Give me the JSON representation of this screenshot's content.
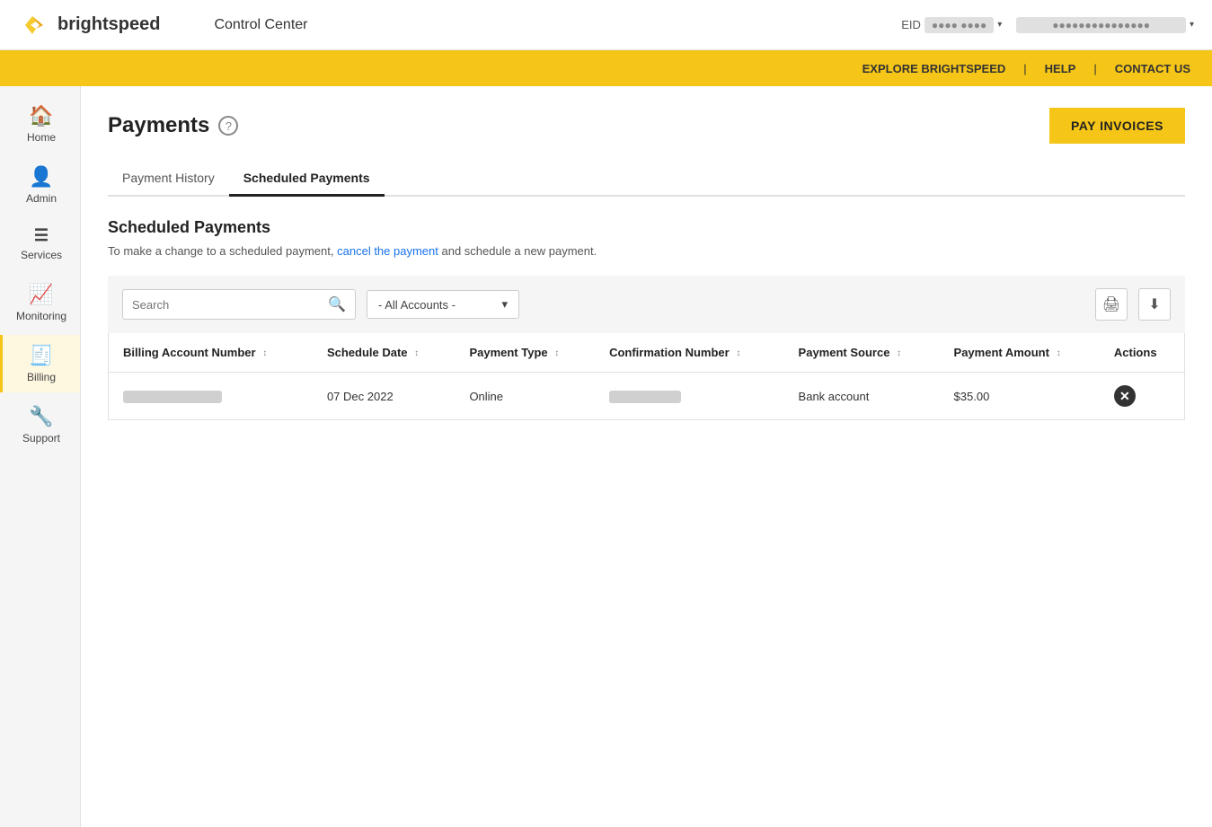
{
  "topnav": {
    "logo_text": "brightspeed",
    "app_title": "Control Center",
    "eid_label": "EID",
    "eid_value": "●●●● ●●●●",
    "user_value": "●●●●●●●●●●●●●●●",
    "chevron": "▾"
  },
  "yellowbar": {
    "links": [
      "EXPLORE BRIGHTSPEED",
      "HELP",
      "CONTACT US"
    ]
  },
  "sidebar": {
    "items": [
      {
        "id": "home",
        "icon": "🏠",
        "label": "Home"
      },
      {
        "id": "admin",
        "icon": "👤",
        "label": "Admin"
      },
      {
        "id": "services",
        "icon": "≡",
        "label": "Services"
      },
      {
        "id": "monitoring",
        "icon": "📊",
        "label": "Monitoring"
      },
      {
        "id": "billing",
        "icon": "🧾",
        "label": "Billing",
        "active": true
      },
      {
        "id": "support",
        "icon": "🔧",
        "label": "Support"
      }
    ]
  },
  "page": {
    "title": "Payments",
    "help_icon": "?",
    "pay_invoices_btn": "PAY INVOICES"
  },
  "tabs": [
    {
      "id": "payment-history",
      "label": "Payment History",
      "active": false
    },
    {
      "id": "scheduled-payments",
      "label": "Scheduled Payments",
      "active": true
    }
  ],
  "section": {
    "title": "Scheduled Payments",
    "description_prefix": "To make a change to a scheduled payment,",
    "description_link": "cancel the payment",
    "description_suffix": "and schedule a new payment."
  },
  "filter": {
    "search_placeholder": "Search",
    "accounts_label": "- All Accounts -",
    "print_icon": "🖨",
    "download_icon": "⬇"
  },
  "table": {
    "columns": [
      {
        "id": "billing-account",
        "label": "Billing Account Number"
      },
      {
        "id": "schedule-date",
        "label": "Schedule Date"
      },
      {
        "id": "payment-type",
        "label": "Payment Type"
      },
      {
        "id": "confirmation-number",
        "label": "Confirmation Number"
      },
      {
        "id": "payment-source",
        "label": "Payment Source"
      },
      {
        "id": "payment-amount",
        "label": "Payment Amount"
      },
      {
        "id": "actions",
        "label": "Actions"
      }
    ],
    "rows": [
      {
        "billing_account": "REDACTED",
        "schedule_date": "07 Dec 2022",
        "payment_type": "Online",
        "confirmation_number": "REDACTED_SM",
        "payment_source": "Bank account",
        "payment_amount": "$35.00"
      }
    ]
  }
}
